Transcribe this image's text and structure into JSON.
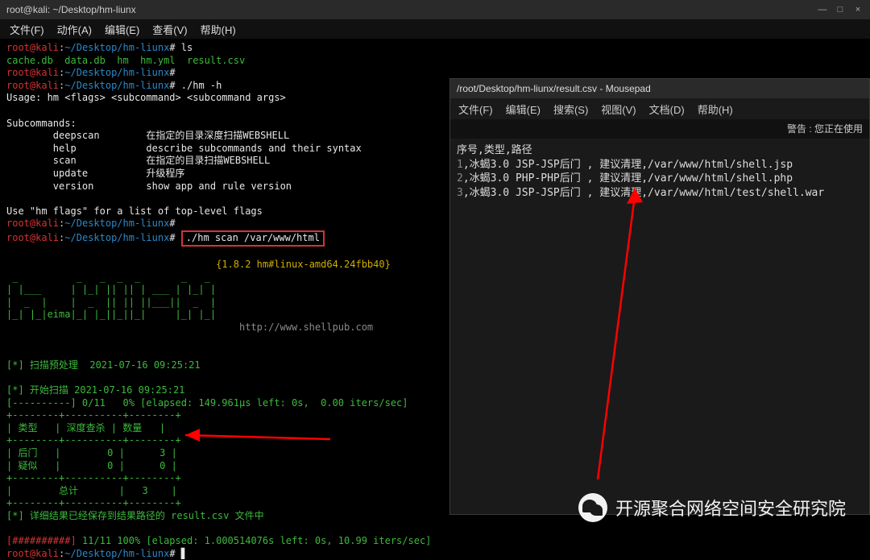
{
  "main_window": {
    "title": "root@kali: ~/Desktop/hm-liunx",
    "menu": [
      "文件(F)",
      "动作(A)",
      "编辑(E)",
      "查看(V)",
      "帮助(H)"
    ],
    "win_controls": {
      "min": "—",
      "max": "□",
      "close": "×"
    }
  },
  "terminal": {
    "prompt": {
      "user": "root@kali",
      "sep": ":",
      "cwd": "~/Desktop/hm-liunx",
      "hash": "#"
    },
    "cmd_ls": "ls",
    "ls_out": "cache.db  data.db  hm  hm.yml  result.csv",
    "cmd_help": "./hm -h",
    "usage": "Usage: hm <flags> <subcommand> <subcommand args>",
    "sub_heading": "Subcommands:",
    "subs": [
      {
        "name": "deepscan",
        "desc": "在指定的目录深度扫描WEBSHELL"
      },
      {
        "name": "help",
        "desc": "describe subcommands and their syntax"
      },
      {
        "name": "scan",
        "desc": "在指定的目录扫描WEBSHELL"
      },
      {
        "name": "update",
        "desc": "升级程序"
      },
      {
        "name": "version",
        "desc": "show app and rule version"
      }
    ],
    "flags_hint": "Use \"hm flags\" for a list of top-level flags",
    "cmd_scan": "./hm scan /var/www/html",
    "banner_version": "{1.8.2 hm#linux-amd64.24fbb40}",
    "ascii_art": " __             \n|  |            \n|  |--  .--.--. \n|  .  | |        \n|__|__| |__|__| ",
    "banner_url": "http://www.shellpub.com",
    "pre_line": "[*] 扫描预处理  2021-07-16 09:25:21",
    "start_line": "[*] 开始扫描 2021-07-16 09:25:21",
    "progress0": "[----------] 0/11   0% [elapsed: 149.961µs left: 0s,  0.00 iters/sec]",
    "table_div": "+--------+----------+--------+",
    "table_head": "| 类型   | 深度查杀 | 数量   |",
    "table_row1": "| 后门   |        0 |      3 |",
    "table_row2": "| 疑似   |        0 |      0 |",
    "table_sum": "|        总计       |   3    |",
    "saved_line": "[*] 详细结果已经保存到结果路径的 result.csv 文件中",
    "progress1_bar": "[##########]",
    "progress1_rest": " 11/11 100% [elapsed: 1.000514076s left: 0s, 10.99 iters/sec]"
  },
  "mousepad": {
    "title": "/root/Desktop/hm-liunx/result.csv - Mousepad",
    "menu": [
      "文件(F)",
      "编辑(E)",
      "搜索(S)",
      "视图(V)",
      "文档(D)",
      "帮助(H)"
    ],
    "warn": "警告 : 您正在使用",
    "header": "序号,类型,路径",
    "rows": [
      {
        "n": "1",
        "body": ",冰蝎3.0 JSP-JSP后门 , 建议清理,/var/www/html/shell.jsp"
      },
      {
        "n": "2",
        "body": ",冰蝎3.0 PHP-PHP后门 , 建议清理,/var/www/html/shell.php"
      },
      {
        "n": "3",
        "body": ",冰蝎3.0 JSP-JSP后门 , 建议清理,/var/www/html/test/shell.war"
      }
    ]
  },
  "watermark": "开源聚合网络空间安全研究院"
}
